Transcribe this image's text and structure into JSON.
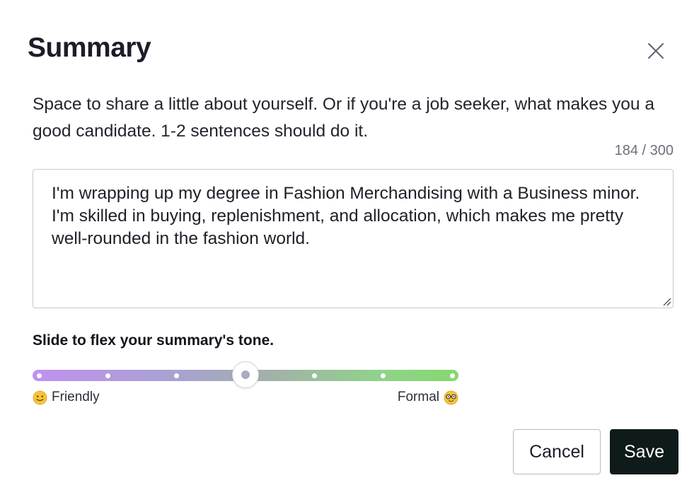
{
  "modal": {
    "title": "Summary",
    "close_icon": "close-icon",
    "description": "Space to share a little about yourself. Or if you're a job seeker, what makes you a good candidate. 1-2 sentences should do it.",
    "char_counter": "184 / 300"
  },
  "summary": {
    "value": "I'm wrapping up my degree in Fashion Merchandising with a Business minor. I'm skilled in buying, replenishment, and allocation, which makes me pretty well-rounded in the fashion world."
  },
  "tone_slider": {
    "label": "Slide to flex your summary's tone.",
    "min_label": "Friendly",
    "max_label": "Formal",
    "min_icon": "slightly-smiling-face-icon",
    "max_icon": "nerd-face-icon",
    "steps": 7,
    "selected_step": 4,
    "gradient_start": "#c190f0",
    "gradient_end": "#86d86e"
  },
  "actions": {
    "cancel_label": "Cancel",
    "save_label": "Save",
    "save_color": "#0f1a1a"
  }
}
